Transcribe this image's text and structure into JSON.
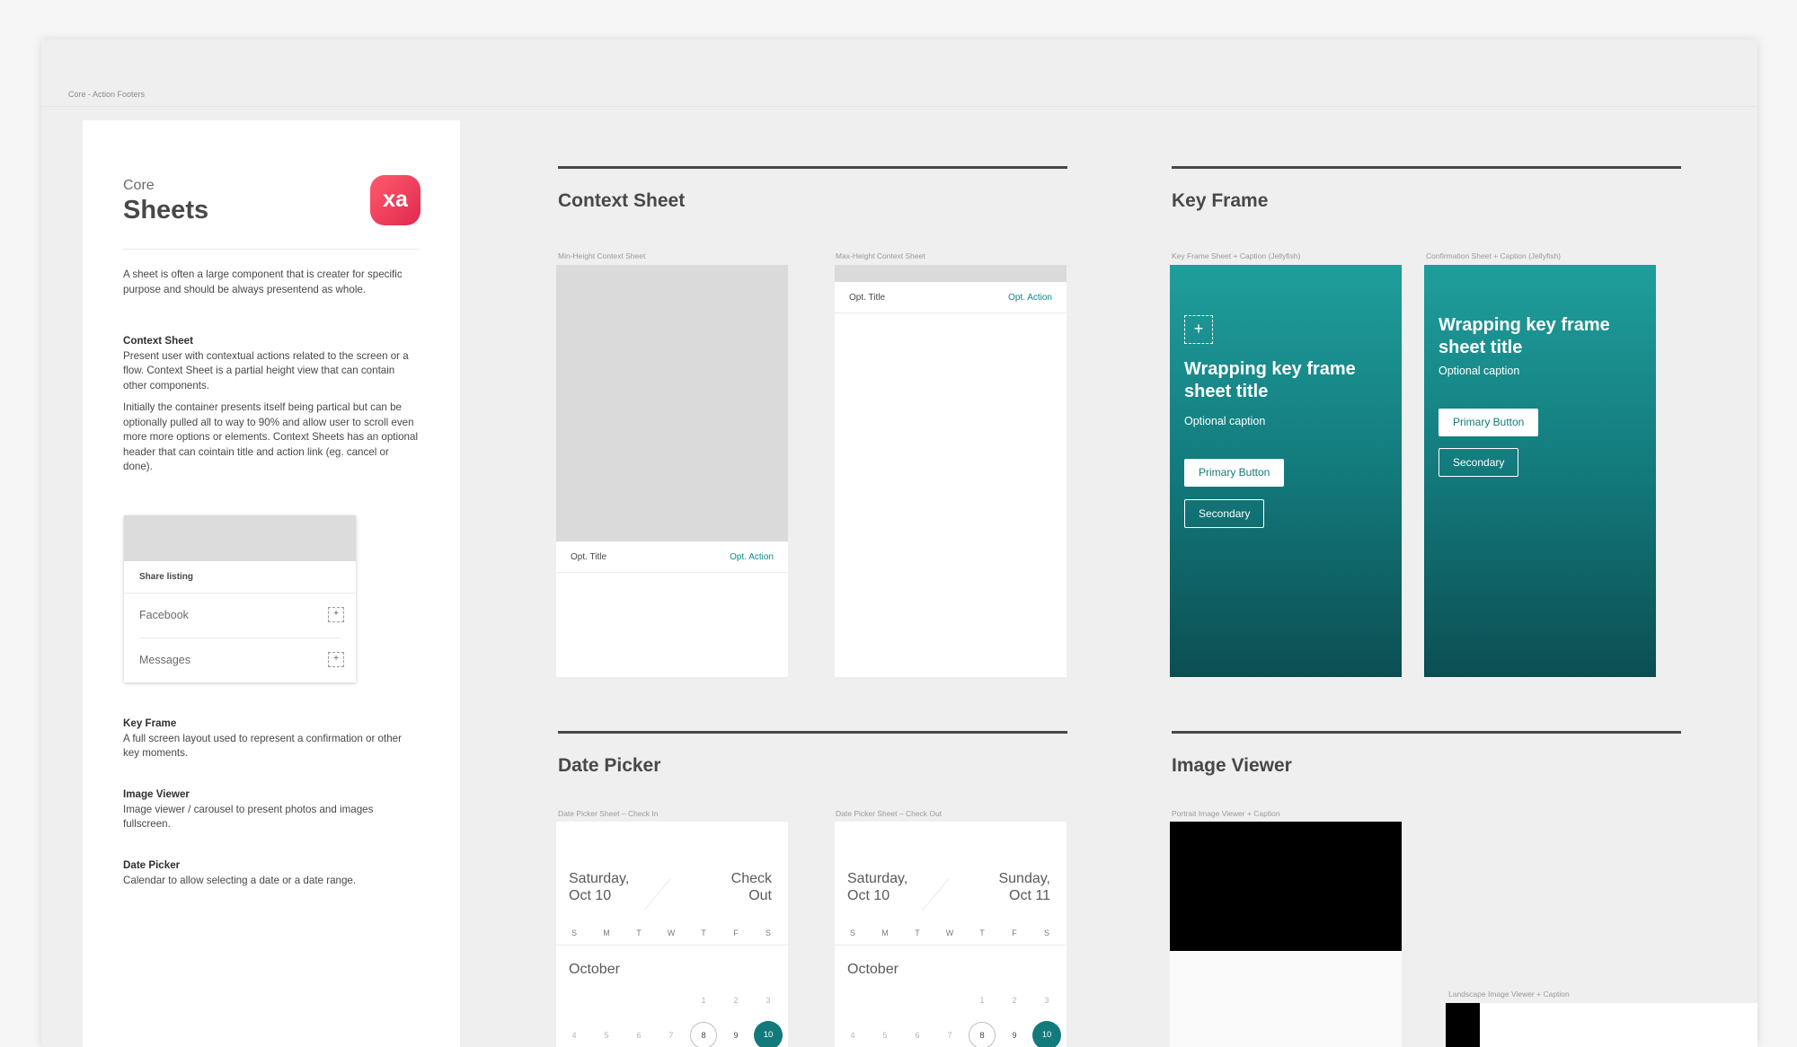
{
  "breadcrumb": "Core - Action Footers",
  "panel": {
    "kicker": "Core",
    "title": "Sheets",
    "logo_text": "xa",
    "intro": "A sheet is often a large component that is creater for specific purpose and should be always presentend as whole.",
    "context_sheet_heading": "Context Sheet",
    "context_sheet_text": "Present user with contextual actions related to the screen or a flow. Context Sheet is a partial height view that can contain other components.",
    "context_sheet_text2": "Initially the container presents itself being partical but can be optionally pulled all to way to 90% and allow user to scroll even more more options or elements. Context Sheets has an optional header that can cointain title and action link (eg. cancel or done).",
    "example": {
      "header": "Share listing",
      "rows": [
        "Facebook",
        "Messages"
      ]
    },
    "key_frame_heading": "Key Frame",
    "key_frame_text": "A full screen layout used to represent a confirmation or other key moments.",
    "image_viewer_heading": "Image Viewer",
    "image_viewer_text": "Image viewer / carousel to present photos and images fullscreen.",
    "date_picker_heading": "Date Picker",
    "date_picker_text": "Calendar to allow selecting a date or a date range."
  },
  "sections": {
    "context_sheet": {
      "title": "Context Sheet",
      "min_label": "Min-Height Context Sheet",
      "max_label": "Max-Height Context Sheet",
      "opt_title": "Opt. Title",
      "opt_action": "Opt. Action"
    },
    "key_frame": {
      "title": "Key Frame",
      "label_1": "Key Frame Sheet + Caption (Jellyfish)",
      "label_2": "Confirmation Sheet + Caption (Jellyfish)",
      "sheet_title": "Wrapping key frame sheet title",
      "caption": "Optional caption",
      "primary": "Primary Button",
      "secondary": "Secondary"
    },
    "date_picker": {
      "title": "Date Picker",
      "label_in": "Date Picker Sheet – Check In",
      "label_out": "Date Picker Sheet – Check Out",
      "in_start": [
        "Saturday,",
        "Oct 10"
      ],
      "in_end": [
        "Check",
        "Out"
      ],
      "out_start": [
        "Saturday,",
        "Oct 10"
      ],
      "out_end": [
        "Sunday,",
        "Oct 11"
      ],
      "weekdays": [
        "S",
        "M",
        "T",
        "W",
        "T",
        "F",
        "S"
      ],
      "month": "October",
      "row1": [
        "1",
        "2",
        "3"
      ],
      "row2": [
        "4",
        "5",
        "6",
        "7",
        "8",
        "9",
        "10"
      ]
    },
    "image_viewer": {
      "title": "Image Viewer",
      "portrait_label": "Portrait Image Viewer + Caption",
      "landscape_label": "Landscape Image Viewer + Caption"
    }
  },
  "colors": {
    "teal": "#137a7c",
    "brand": "#ff5a6d",
    "link": "#0a8a8a"
  }
}
